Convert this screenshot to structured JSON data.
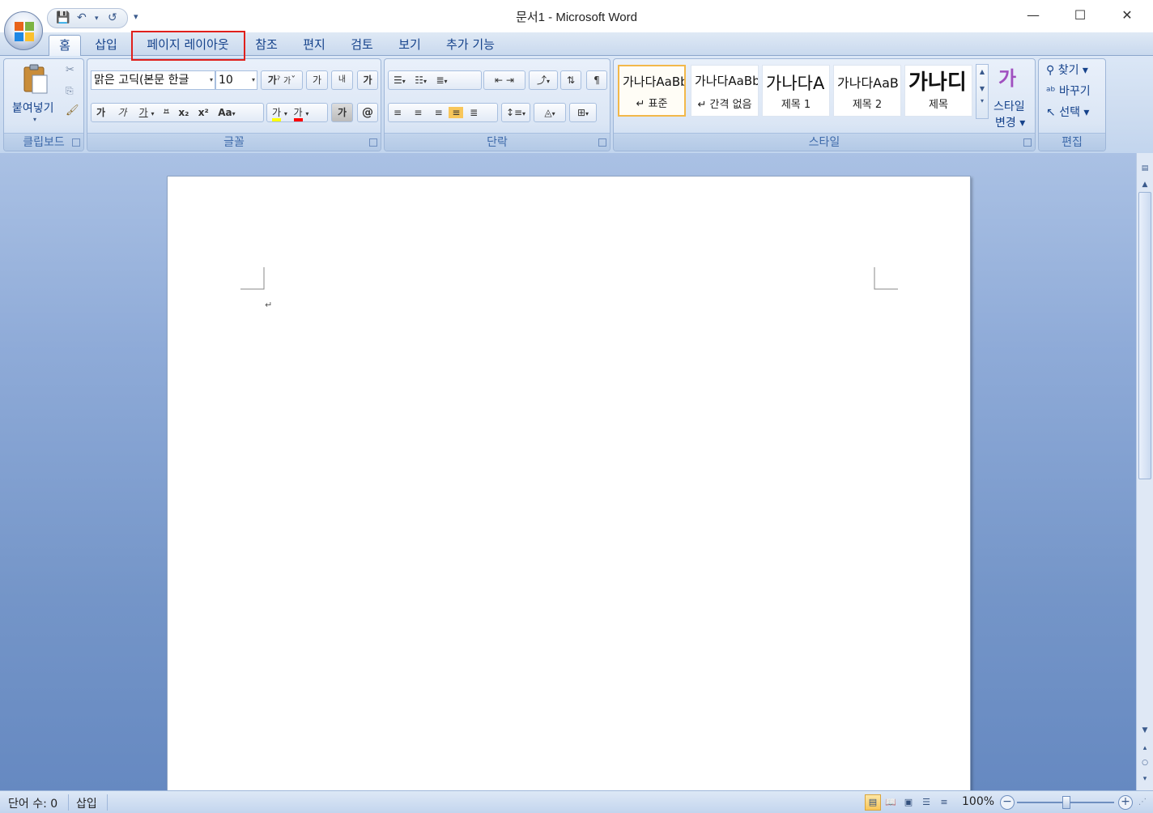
{
  "window": {
    "title": "문서1 - Microsoft Word",
    "minimize": "—",
    "maximize": "☐",
    "close": "✕"
  },
  "qat": {
    "save_icon": "save-icon",
    "undo_icon": "undo-icon",
    "redo_icon": "redo-icon"
  },
  "tabs": [
    {
      "label": "홈",
      "active": true
    },
    {
      "label": "삽입"
    },
    {
      "label": "페이지 레이아웃",
      "highlighted": true
    },
    {
      "label": "참조"
    },
    {
      "label": "편지"
    },
    {
      "label": "검토"
    },
    {
      "label": "보기"
    },
    {
      "label": "추가 기능"
    }
  ],
  "clipboard": {
    "paste_label": "붙여넣기",
    "group_label": "클립보드"
  },
  "font": {
    "name": "맑은 고딕(본문 한글",
    "size": "10",
    "grow_label": "가",
    "shrink_label": "가",
    "clear_label": "가",
    "phonetic_label": "내",
    "border_label": "가",
    "bold": "가",
    "italic": "가",
    "underline": "가",
    "strike": "ꟸ",
    "subscript": "x₂",
    "superscript": "x²",
    "case": "Aa",
    "highlight": "가",
    "color": "가",
    "shade_label": "가",
    "enclose_label": "@",
    "group_label": "글꼴"
  },
  "paragraph": {
    "group_label": "단락"
  },
  "styles": {
    "items": [
      {
        "sample": "가나다AaBb",
        "name": "↵ 표준",
        "selected": true
      },
      {
        "sample": "가나다AaBb",
        "name": "↵ 간격 없음"
      },
      {
        "sample": "가나다A",
        "name": "제목 1"
      },
      {
        "sample": "가나다AaB",
        "name": "제목 2"
      },
      {
        "sample": "가나디",
        "name": "제목"
      }
    ],
    "change_label_1": "스타일",
    "change_label_2": "변경 ▾",
    "group_label": "스타일"
  },
  "editing": {
    "find": "찾기 ▾",
    "replace": "바꾸기",
    "select": "선택 ▾",
    "group_label": "편집"
  },
  "document": {
    "paragraph_mark": "↵"
  },
  "status": {
    "word_count": "단어 수: 0",
    "mode": "삽입",
    "zoom": "100%"
  },
  "colors": {
    "accent": "#15428b",
    "highlight_border": "#e0201c",
    "highlight_yellow": "#ffff00",
    "font_red": "#ff0000"
  }
}
